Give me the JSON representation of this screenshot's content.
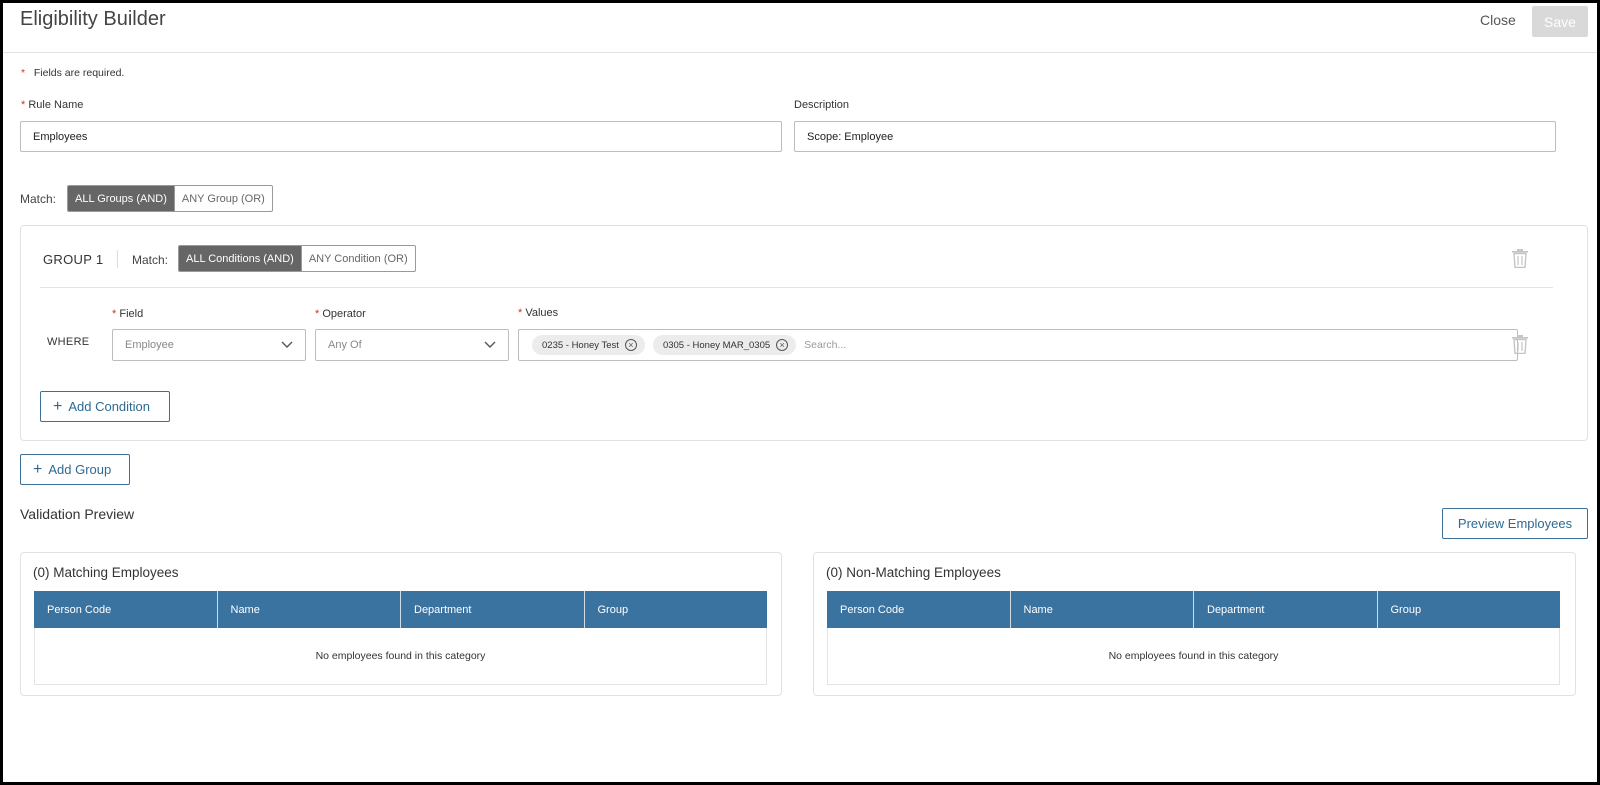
{
  "header": {
    "title": "Eligibility Builder",
    "close_label": "Close",
    "save_label": "Save"
  },
  "form": {
    "required_marker": "*",
    "required_note": "Fields are required.",
    "rule_name_label": "Rule Name",
    "rule_name_value": "Employees",
    "description_label": "Description",
    "description_value": "Scope: Employee"
  },
  "match_groups": {
    "label": "Match:",
    "options": [
      "ALL Groups (AND)",
      "ANY Group (OR)"
    ],
    "selected": "ALL Groups (AND)"
  },
  "group": {
    "title": "GROUP 1",
    "match_label": "Match:",
    "options": [
      "ALL Conditions (AND)",
      "ANY Condition (OR)"
    ],
    "selected": "ALL Conditions (AND)",
    "where_label": "WHERE",
    "field_label": "Field",
    "field_value": "Employee",
    "operator_label": "Operator",
    "operator_value": "Any Of",
    "values_label": "Values",
    "values": [
      "0235 - Honey Test",
      "0305 - Honey MAR_0305"
    ],
    "search_placeholder": "Search...",
    "add_condition_label": "Add Condition"
  },
  "add_group_label": "Add Group",
  "validation": {
    "title": "Validation Preview",
    "preview_button": "Preview Employees",
    "matching": {
      "title": "(0) Matching Employees",
      "empty": "No employees found in this category"
    },
    "non_matching": {
      "title": "(0) Non-Matching Employees",
      "empty": "No employees found in this category"
    },
    "columns": [
      "Person Code",
      "Name",
      "Department",
      "Group"
    ]
  },
  "colors": {
    "table_header": "#3a72a0",
    "accent": "#2e6a92",
    "toggle_active": "#666666",
    "required": "#c0392b"
  }
}
